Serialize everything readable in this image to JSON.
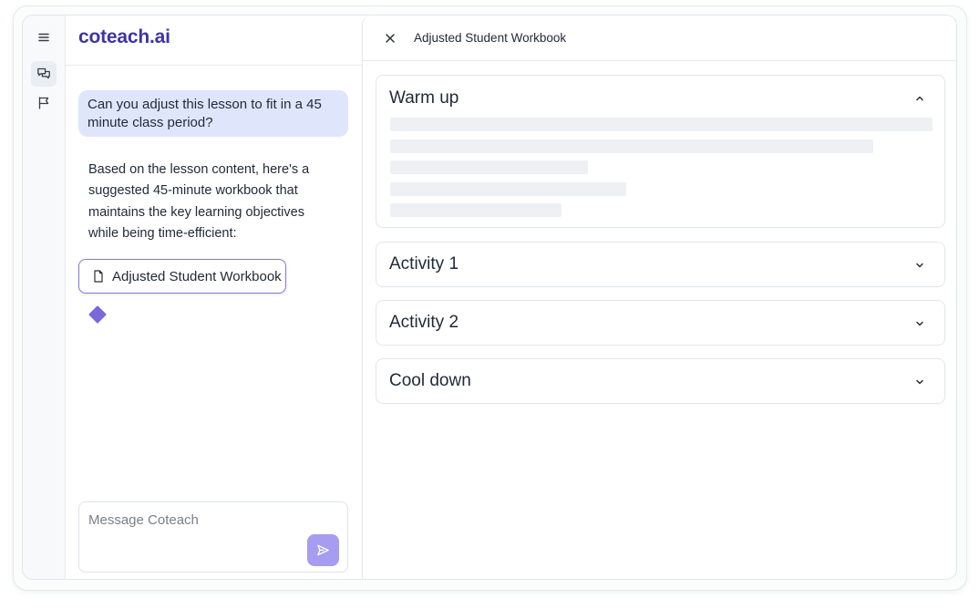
{
  "app": {
    "logo_main": "coteach",
    "logo_suffix": ".ai"
  },
  "rail": {
    "items": [
      {
        "icon": "menu-icon"
      },
      {
        "icon": "chat-icon",
        "active": true
      },
      {
        "icon": "flag-icon"
      }
    ]
  },
  "chat": {
    "user_message": "Can you adjust this lesson to fit in a 45 minute class period?",
    "assistant_message": "Based on the lesson content, here's a suggested 45-minute workbook that maintains the key learning objectives while being time-efficient:",
    "artifact_chip_label": "Adjusted Student Workbook",
    "composer_placeholder": "Message Coteach"
  },
  "artifact": {
    "title": "Adjusted Student Workbook",
    "sections": [
      {
        "title": "Warm up",
        "expanded": true
      },
      {
        "title": "Activity 1",
        "expanded": false
      },
      {
        "title": "Activity 2",
        "expanded": false
      },
      {
        "title": "Cool down",
        "expanded": false
      }
    ]
  },
  "colors": {
    "brand": "#3f33a8",
    "user_bubble": "#dfe6fb",
    "chip_border": "#7f7ad6",
    "send_button": "#a79df0",
    "skeleton": "#eef0f3"
  }
}
